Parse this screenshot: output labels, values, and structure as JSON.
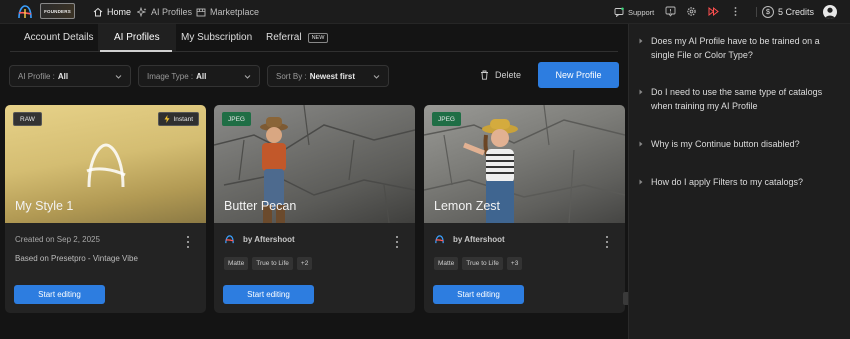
{
  "topbar": {
    "founders_badge": "FOUNDERS",
    "nav": [
      {
        "label": "Home",
        "icon": "home-icon"
      },
      {
        "label": "AI Profiles",
        "icon": "sparkle-icon"
      },
      {
        "label": "Marketplace",
        "icon": "store-icon"
      }
    ],
    "support_label": "Support",
    "credits_label": "5 Credits",
    "coin_symbol": "$"
  },
  "tabs": [
    {
      "label": "Account Details"
    },
    {
      "label": "AI Profiles",
      "active": true
    },
    {
      "label": "My Subscription"
    },
    {
      "label": "Referral",
      "badge": "NEW"
    }
  ],
  "filters": {
    "ai_profile": {
      "label": "AI Profile :",
      "value": "All"
    },
    "image_type": {
      "label": "Image Type :",
      "value": "All"
    },
    "sort_by": {
      "label": "Sort By :",
      "value": "Newest first"
    }
  },
  "actions": {
    "delete_label": "Delete",
    "new_profile_label": "New Profile"
  },
  "cards": [
    {
      "type_badge": "RAW",
      "instant_badge": "Instant",
      "title": "My Style 1",
      "created": "Created on Sep 2, 2025",
      "based_on": "Based on Presetpro - Vintage Vibe",
      "button": "Start editing"
    },
    {
      "type_badge": "JPEG",
      "title": "Butter Pecan",
      "by": "by Aftershoot",
      "chips": [
        "Matte",
        "True to Life",
        "+2"
      ],
      "button": "Start editing"
    },
    {
      "type_badge": "JPEG",
      "title": "Lemon Zest",
      "by": "by Aftershoot",
      "chips": [
        "Matte",
        "True to Life",
        "+3"
      ],
      "button": "Start editing"
    }
  ],
  "faq": [
    {
      "question": "Does my AI Profile have to be trained on a single File or Color Type?"
    },
    {
      "question": "Do I need to use the same type of catalogs when training my AI Profile"
    },
    {
      "question": "Why is my Continue button disabled?"
    },
    {
      "question": "How do I apply Filters to my catalogs?"
    }
  ],
  "colors": {
    "accent_blue": "#2d7de0",
    "jpeg_badge_green": "#1f6e45",
    "background": "#141414"
  }
}
